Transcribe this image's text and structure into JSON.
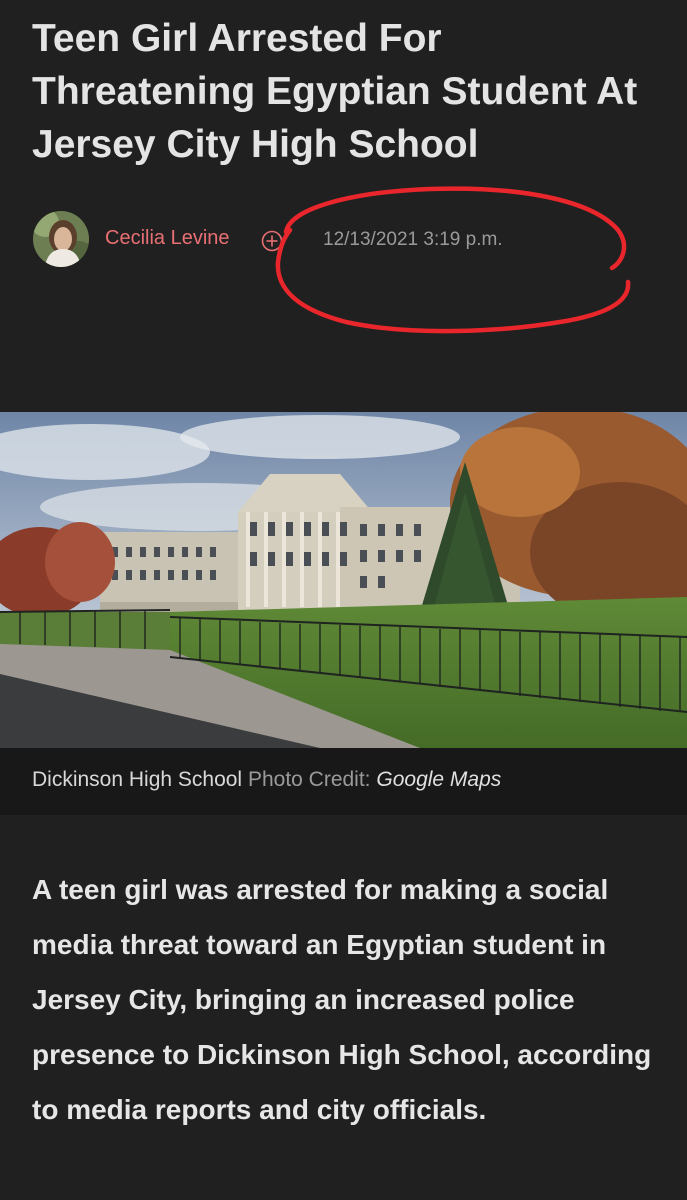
{
  "article": {
    "headline": "Teen Girl Arrested For Threatening Egyptian Student At Jersey City High School",
    "author": "Cecilia Levine",
    "follow_icon": "plus-circle-icon",
    "timestamp": "12/13/2021 3:19 p.m.",
    "image": {
      "caption_subject": "Dickinson High School",
      "credit_label": "Photo Credit:",
      "credit_source": "Google Maps"
    },
    "lead_paragraph": "A teen girl was arrested for making a social media threat toward an Egyptian student in Jersey City, bringing an increased police presence to Dickinson High School, according to media reports and city officials."
  },
  "colors": {
    "background": "#202020",
    "author_link": "#e86f73",
    "annotation_red": "#e8262b",
    "caption_bar": "#181818"
  }
}
